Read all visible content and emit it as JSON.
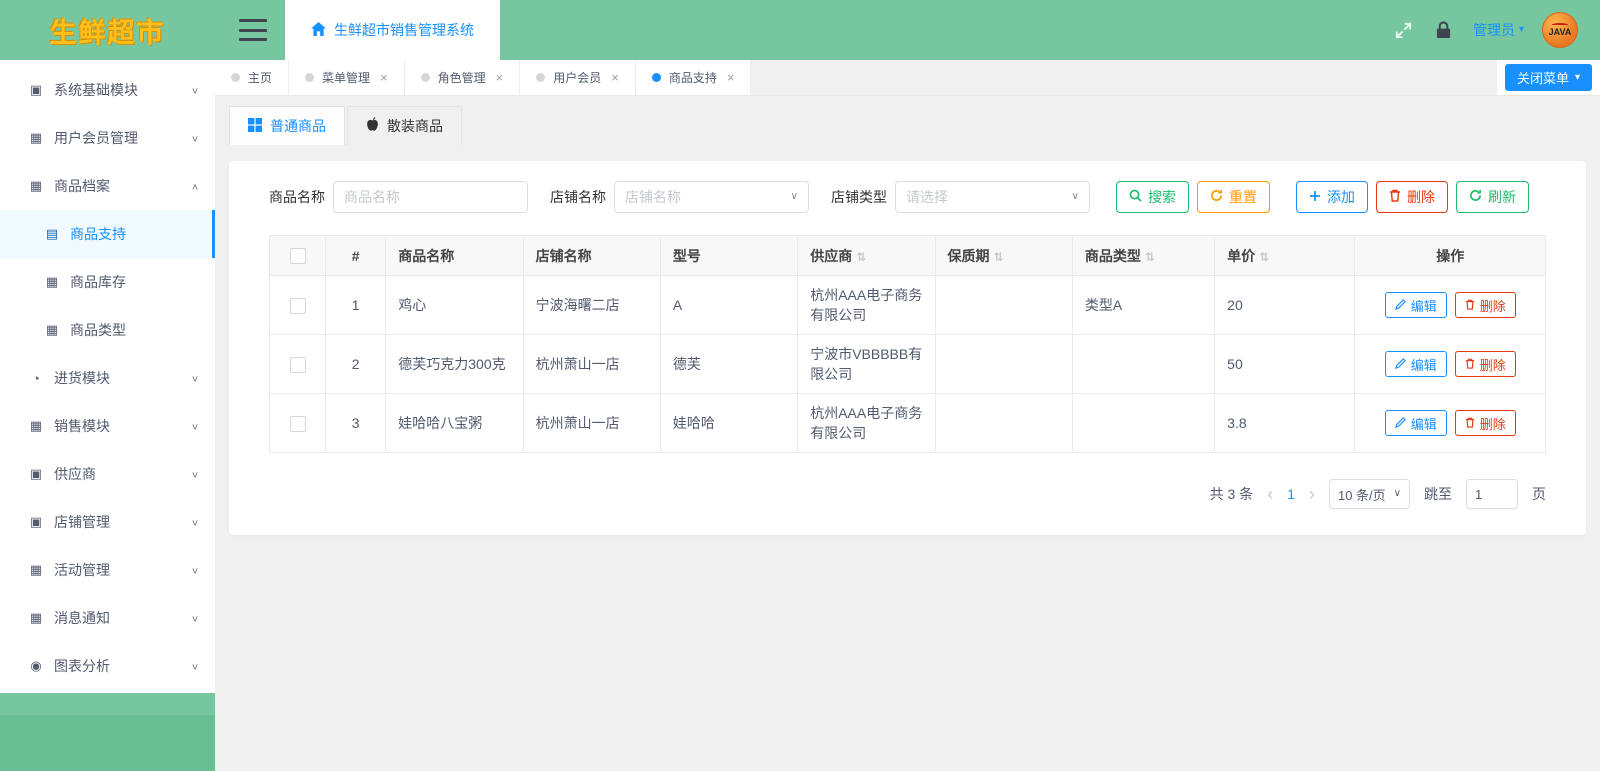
{
  "app": {
    "logo": "生鲜超市",
    "system_title": "生鲜超市销售管理系统",
    "admin_label": "管理员",
    "avatar_text": "JAVA"
  },
  "icons": {
    "close": "×",
    "chevron_down": "∨",
    "chevron_up": "∧",
    "caret_down": "▾",
    "select_caret": "∨",
    "sort": "⇅",
    "prev": "‹",
    "next": "›",
    "grid": "▦",
    "panel": "▣",
    "clock": "◔",
    "chart": "◉",
    "book": "▤"
  },
  "sidebar": {
    "items": [
      {
        "label": "系统基础模块"
      },
      {
        "label": "用户会员管理"
      },
      {
        "label": "商品档案",
        "expanded": true,
        "children": [
          {
            "label": "商品支持",
            "active": true
          },
          {
            "label": "商品库存"
          },
          {
            "label": "商品类型"
          }
        ]
      },
      {
        "label": "进货模块"
      },
      {
        "label": "销售模块"
      },
      {
        "label": "供应商"
      },
      {
        "label": "店铺管理"
      },
      {
        "label": "活动管理"
      },
      {
        "label": "消息通知"
      },
      {
        "label": "图表分析"
      }
    ]
  },
  "tabs": {
    "items": [
      {
        "label": "主页",
        "closable": false,
        "active": false
      },
      {
        "label": "菜单管理",
        "closable": true,
        "active": false
      },
      {
        "label": "角色管理",
        "closable": true,
        "active": false
      },
      {
        "label": "用户会员",
        "closable": true,
        "active": false
      },
      {
        "label": "商品支持",
        "closable": true,
        "active": true
      }
    ],
    "close_menu_label": "关闭菜单"
  },
  "subtabs": [
    {
      "label": "普通商品",
      "active": true
    },
    {
      "label": "散装商品",
      "active": false
    }
  ],
  "filters": {
    "name_label": "商品名称",
    "name_placeholder": "商品名称",
    "shop_label": "店铺名称",
    "shop_placeholder": "店铺名称",
    "type_label": "店铺类型",
    "type_placeholder": "请选择",
    "buttons": {
      "search": "搜索",
      "reset": "重置",
      "add": "添加",
      "delete": "删除",
      "refresh": "刷新"
    }
  },
  "table": {
    "headers": [
      "#",
      "商品名称",
      "店铺名称",
      "型号",
      "供应商",
      "保质期",
      "商品类型",
      "单价",
      "操作"
    ],
    "actions": {
      "edit": "编辑",
      "delete": "删除"
    },
    "rows": [
      {
        "index": "1",
        "name": "鸡心",
        "shop": "宁波海曙二店",
        "model": "A",
        "supplier": "杭州AAA电子商务有限公司",
        "shelf": "",
        "type": "类型A",
        "price": "20"
      },
      {
        "index": "2",
        "name": "德芙巧克力300克",
        "shop": "杭州萧山一店",
        "model": "德芙",
        "supplier": "宁波市VBBBBB有限公司",
        "shelf": "",
        "type": "",
        "price": "50"
      },
      {
        "index": "3",
        "name": "娃哈哈八宝粥",
        "shop": "杭州萧山一店",
        "model": "娃哈哈",
        "supplier": "杭州AAA电子商务有限公司",
        "shelf": "",
        "type": "",
        "price": "3.8"
      }
    ]
  },
  "pagination": {
    "total": "共 3 条",
    "current_page": "1",
    "page_size": "10 条/页",
    "jump_label": "跳至",
    "jump_value": "1",
    "page_unit": "页"
  }
}
